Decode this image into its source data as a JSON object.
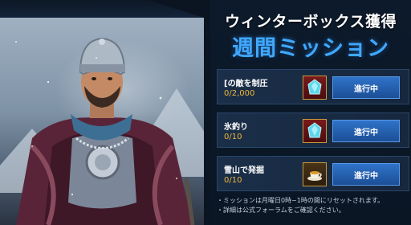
{
  "header": {
    "title_line1": "ウィンターボックス獲得",
    "title_line2": "週間ミッション"
  },
  "missions": [
    {
      "name": "[の敵を制圧",
      "progress": "0/2,000",
      "reward_icon": "ice-crystal-icon",
      "button_label": "進行中"
    },
    {
      "name": "氷釣り",
      "progress": "0/10",
      "reward_icon": "ice-crystal-icon",
      "button_label": "進行中"
    },
    {
      "name": "雪山で発掘",
      "progress": "0/10",
      "reward_icon": "tea-cup-icon",
      "button_label": "進行中"
    }
  ],
  "notes": [
    "・ミッションは月曜日0時~1時の間にリセットされます。",
    "・詳細は公式フォーラムをご確認ください。"
  ],
  "colors": {
    "title_blue": "#3fa8ff",
    "progress_orange": "#f1b63a",
    "button_blue": "#2f73c9",
    "reward_border_gold": "#c79b3c"
  }
}
